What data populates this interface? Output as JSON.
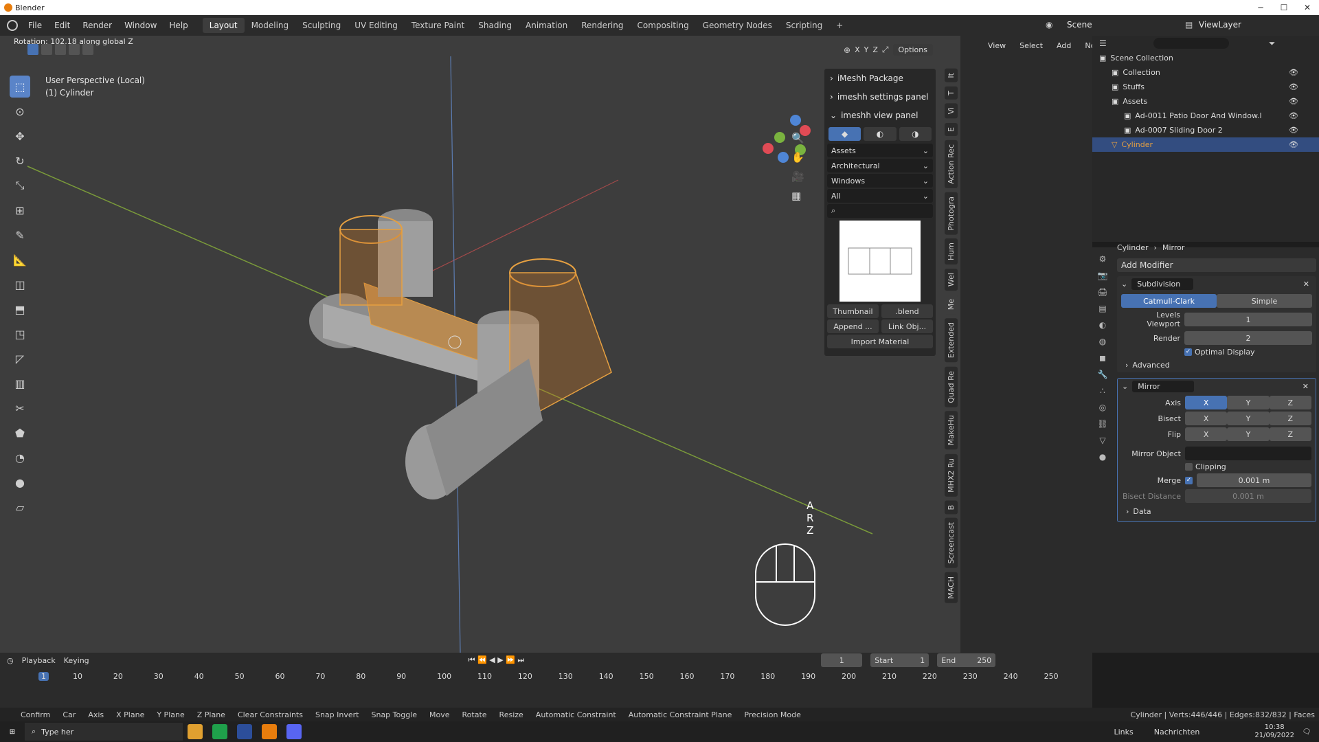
{
  "window": {
    "title": "Blender",
    "minimize": "─",
    "maximize": "☐",
    "close": "✕"
  },
  "menu": [
    "File",
    "Edit",
    "Render",
    "Window",
    "Help"
  ],
  "workspaces": [
    "Layout",
    "Modeling",
    "Sculpting",
    "UV Editing",
    "Texture Paint",
    "Shading",
    "Animation",
    "Rendering",
    "Compositing",
    "Geometry Nodes",
    "Scripting",
    "+"
  ],
  "scene": {
    "label": "Scene",
    "view_layer": "ViewLayer"
  },
  "viewport": {
    "operator_text": "Rotation: 102.18 along global Z",
    "perspective": "User Perspective (Local)",
    "object": "(1) Cylinder",
    "options": "Options",
    "axes": [
      "X",
      "Y",
      "Z"
    ],
    "key_overlay": [
      "A",
      "R",
      "Z"
    ]
  },
  "npanel": {
    "headers": [
      "iMeshh Package",
      "imeshh settings panel",
      "imeshh view panel"
    ],
    "dropdowns": [
      "Assets",
      "Architectural",
      "Windows",
      "All"
    ],
    "thumbnail": "Thumbnail",
    "blend": ".blend",
    "append": "Append ...",
    "link": "Link Obj...",
    "import": "Import Material"
  },
  "vertical_tabs": [
    "It",
    "T",
    "Vi",
    "E",
    "Action Rec",
    "Photogra",
    "Hum",
    "Wel",
    "Me",
    "Extended",
    "Quad Re",
    "MakeHu",
    "MHX2 Ru",
    "B",
    "Screencast",
    "MACH"
  ],
  "node_header": [
    "View",
    "Select",
    "Add",
    "Node"
  ],
  "outliner": {
    "items": [
      {
        "label": "Scene Collection",
        "depth": 0
      },
      {
        "label": "Collection",
        "depth": 1
      },
      {
        "label": "Stuffs",
        "depth": 1
      },
      {
        "label": "Assets",
        "depth": 1
      },
      {
        "label": "Ad-0011 Patio Door And Window.l",
        "depth": 2
      },
      {
        "label": "Ad-0007 Sliding Door 2",
        "depth": 2
      },
      {
        "label": "Cylinder",
        "depth": 1,
        "selected": true
      }
    ]
  },
  "properties": {
    "breadcrumb_object": "Cylinder",
    "breadcrumb_modifier": "Mirror",
    "add_modifier": "Add Modifier",
    "subdivision": {
      "name": "Subdivision",
      "catmull": "Catmull-Clark",
      "simple": "Simple",
      "levels_label": "Levels Viewport",
      "levels": "1",
      "render_label": "Render",
      "render": "2",
      "optimal": "Optimal Display",
      "advanced": "Advanced"
    },
    "mirror": {
      "name": "Mirror",
      "axis_label": "Axis",
      "bisect_label": "Bisect",
      "flip_label": "Flip",
      "xyz": [
        "X",
        "Y",
        "Z"
      ],
      "mirror_object": "Mirror Object",
      "clipping": "Clipping",
      "merge_label": "Merge",
      "merge": "0.001 m",
      "bisect_distance_label": "Bisect Distance",
      "bisect_distance": "0.001 m",
      "data": "Data"
    }
  },
  "timeline": {
    "playback": "Playback",
    "keying": "Keying",
    "current_frame": "1",
    "start_label": "Start",
    "start": "1",
    "end_label": "End",
    "end": "250",
    "ticks": [
      "1",
      "10",
      "20",
      "30",
      "40",
      "50",
      "60",
      "70",
      "80",
      "90",
      "100",
      "110",
      "120",
      "130",
      "140",
      "150",
      "160",
      "170",
      "180",
      "190",
      "200",
      "210",
      "220",
      "230",
      "240",
      "250"
    ]
  },
  "status": {
    "items": [
      "Confirm",
      "Car",
      "Axis",
      "X Plane",
      "Y Plane",
      "Z Plane",
      "Clear Constraints",
      "Snap Invert",
      "Snap Toggle",
      "Move",
      "Rotate",
      "Resize",
      "Automatic Constraint",
      "Automatic Constraint Plane",
      "Precision Mode"
    ],
    "stats": "Cylinder | Verts:446/446 | Edges:832/832 | Faces"
  },
  "taskbar": {
    "search": "Type her",
    "links": "Links",
    "news": "Nachrichten",
    "time": "10:38",
    "date": "21/09/2022"
  }
}
